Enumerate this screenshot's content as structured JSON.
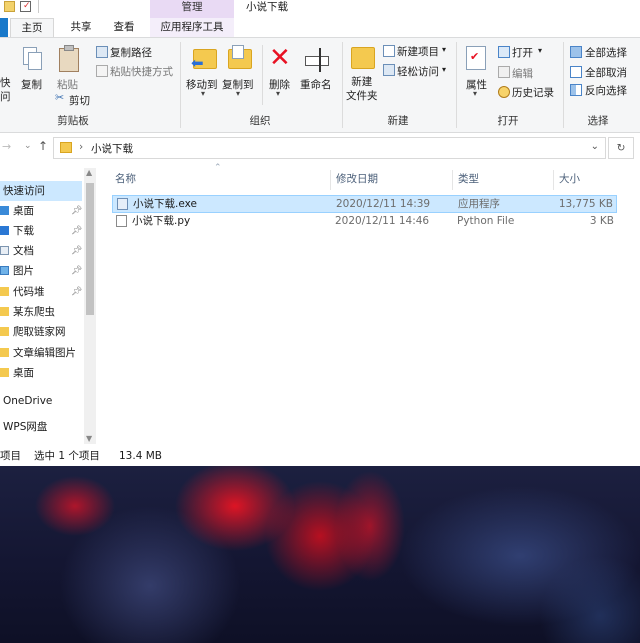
{
  "window": {
    "title": "小说下载",
    "contextual_tab_group": "管理"
  },
  "ribbon_tabs": [
    "主页",
    "共享",
    "查看",
    "应用程序工具"
  ],
  "ribbon": {
    "clipboard": {
      "pin_quick_access_partial": "快\n问",
      "copy": "复制",
      "paste": "粘贴",
      "copy_path": "复制路径",
      "paste_shortcut": "粘贴快捷方式",
      "cut": "剪切",
      "group_label": "剪贴板"
    },
    "organize": {
      "move_to": "移动到",
      "copy_to": "复制到",
      "delete": "删除",
      "rename": "重命名",
      "group_label": "组织"
    },
    "new": {
      "new_folder": "新建\n文件夹",
      "new_item": "新建项目",
      "easy_access": "轻松访问",
      "group_label": "新建"
    },
    "open": {
      "properties": "属性",
      "open": "打开",
      "edit": "编辑",
      "history": "历史记录",
      "group_label": "打开"
    },
    "select": {
      "select_all": "全部选择",
      "select_none": "全部取消",
      "invert_selection": "反向选择",
      "group_label": "选择"
    }
  },
  "address_bar": {
    "path": "小说下载",
    "separator": "›"
  },
  "navigation_pane": {
    "items": [
      {
        "label": "快速访问",
        "icon": "star-icon",
        "pinned": false
      },
      {
        "label": "桌面",
        "icon": "desktop-icon",
        "pinned": true
      },
      {
        "label": "下载",
        "icon": "download-icon",
        "pinned": true
      },
      {
        "label": "文档",
        "icon": "document-icon",
        "pinned": true
      },
      {
        "label": "图片",
        "icon": "picture-icon",
        "pinned": true
      },
      {
        "label": "代码堆",
        "icon": "folder-icon",
        "pinned": true
      },
      {
        "label": "某东爬虫",
        "icon": "folder-icon",
        "pinned": false
      },
      {
        "label": "爬取链家网",
        "icon": "folder-icon",
        "pinned": false
      },
      {
        "label": "文章编辑图片",
        "icon": "folder-icon",
        "pinned": false
      },
      {
        "label": "桌面",
        "icon": "folder-icon",
        "pinned": false
      },
      {
        "label": "OneDrive",
        "icon": "cloud-icon",
        "pinned": false
      },
      {
        "label": "WPS网盘",
        "icon": "cloud-icon",
        "pinned": false
      }
    ]
  },
  "file_list": {
    "columns": [
      "名称",
      "修改日期",
      "类型",
      "大小"
    ],
    "rows": [
      {
        "name": "小说下载.exe",
        "modified": "2020/12/11 14:39",
        "type": "应用程序",
        "size": "13,775 KB",
        "selected": true,
        "icon": "exe-icon"
      },
      {
        "name": "小说下载.py",
        "modified": "2020/12/11 14:46",
        "type": "Python File",
        "size": "3 KB",
        "selected": false,
        "icon": "python-file-icon"
      }
    ]
  },
  "status_bar": {
    "item_count_partial": "项目",
    "selection": "选中 1 个项目",
    "selection_size": "13.4 MB"
  },
  "colors": {
    "accent": "#1979ca",
    "selection_bg": "#cce8ff",
    "selection_border": "#99d1ff",
    "contextual_tab": "#e9daf4",
    "folder": "#f4c94f",
    "delete_red": "#e81123"
  }
}
